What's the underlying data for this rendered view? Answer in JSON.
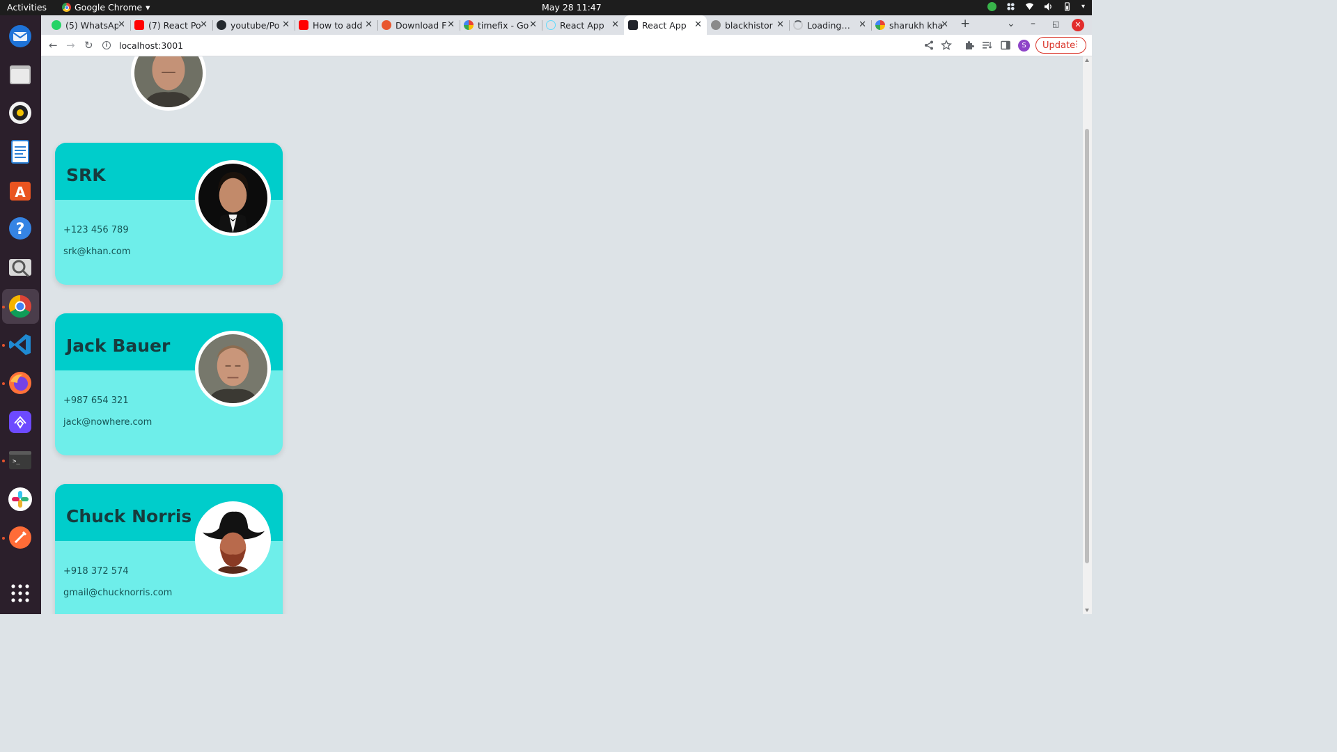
{
  "os_bar": {
    "activities": "Activities",
    "app_name": "Google Chrome",
    "app_menu_arrow": "▾",
    "clock": "May 28  11:47"
  },
  "browser": {
    "tabs": [
      {
        "title": "(5) WhatsAp",
        "icon": "whatsapp-icon",
        "color": "#25d366"
      },
      {
        "title": "(7) React Po",
        "icon": "youtube-icon",
        "color": "#ff0000"
      },
      {
        "title": "youtube/Po",
        "icon": "github-icon",
        "color": "#24292e"
      },
      {
        "title": "How to add",
        "icon": "youtube-icon",
        "color": "#ff0000"
      },
      {
        "title": "Download F",
        "icon": "download-site-icon",
        "color": "#e8572f"
      },
      {
        "title": "timefix - Go",
        "icon": "google-icon",
        "color": "#4285f4"
      },
      {
        "title": "React App",
        "icon": "react-icon",
        "color": "#61dafb"
      },
      {
        "title": "React App",
        "icon": "react-icon",
        "color": "#61dafb",
        "active": true
      },
      {
        "title": "blackhistor",
        "icon": "globe-icon",
        "color": "#8a8a8a"
      },
      {
        "title": "Loading…",
        "icon": "loading-spinner-icon",
        "color": "#5f6368"
      },
      {
        "title": "sharukh kha",
        "icon": "google-icon",
        "color": "#4285f4"
      }
    ],
    "new_tab_symbol": "+",
    "url": "localhost:3001",
    "update_label": "Update",
    "profile_initial": "S"
  },
  "contacts": [
    {
      "name": "SRK",
      "phone": "+123 456 789",
      "email": "srk@khan.com"
    },
    {
      "name": "Jack Bauer",
      "phone": "+987 654 321",
      "email": "jack@nowhere.com"
    },
    {
      "name": "Chuck Norris",
      "phone": "+918 372 574",
      "email": "gmail@chucknorris.com"
    }
  ],
  "colors": {
    "page_bg": "#dde3e7",
    "card_head": "#00cdcb",
    "card_body": "#6eeeea",
    "text_dark": "#173b3d"
  }
}
